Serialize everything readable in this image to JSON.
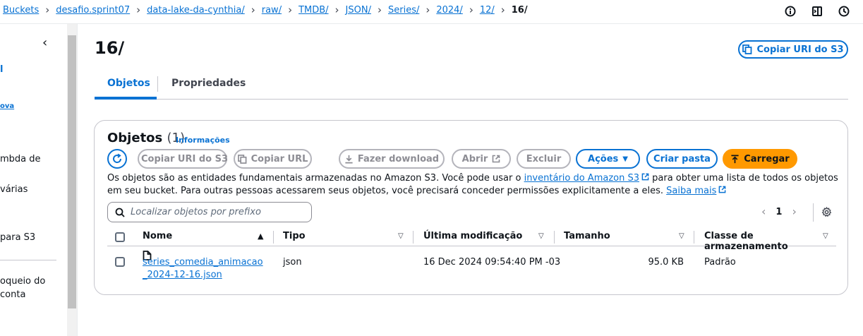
{
  "breadcrumbs": [
    "Buckets",
    "desafio.sprint07",
    "data-lake-da-cynthia/",
    "raw/",
    "TMDB/",
    "JSON/",
    "Series/",
    "2024/",
    "12/"
  ],
  "breadcrumb_current": "16/",
  "leftnav": {
    "fragments": [
      "l",
      "ova",
      "mbda de",
      "várias",
      "para S3",
      "oqueio do",
      "conta"
    ]
  },
  "page": {
    "title": "16/",
    "copy_uri_label": "Copiar URI do S3"
  },
  "tabs": [
    {
      "label": "Objetos",
      "active": true
    },
    {
      "label": "Propriedades",
      "active": false
    }
  ],
  "panel": {
    "title": "Objetos",
    "count": "(1)",
    "info_link": "Informações"
  },
  "toolbar": {
    "copy_s3_uri": "Copiar URI do S3",
    "copy_url": "Copiar URL",
    "download": "Fazer download",
    "open": "Abrir",
    "delete": "Excluir",
    "actions": "Ações",
    "create_folder": "Criar pasta",
    "upload": "Carregar"
  },
  "description": {
    "part1": "Os objetos são as entidades fundamentais armazenadas no Amazon S3. Você pode usar o ",
    "link1": "inventário do Amazon S3",
    "part2": " para obter uma lista de todos os objetos em seu bucket. Para outras pessoas acessarem seus objetos, você precisará conceder permissões explicitamente a eles. ",
    "link2": "Saiba mais"
  },
  "search": {
    "placeholder": "Localizar objetos por prefixo"
  },
  "pagination": {
    "current_page": "1"
  },
  "table": {
    "columns": [
      "Nome",
      "Tipo",
      "Última modificação",
      "Tamanho",
      "Classe de armazenamento"
    ],
    "rows": [
      {
        "name": "series_comedia_animacao_2024-12-16.json",
        "type": "json",
        "last_modified": "16 Dec 2024 09:54:40 PM -03",
        "size": "95.0 KB",
        "storage_class": "Padrão"
      }
    ]
  },
  "colors": {
    "link": "#0972d3",
    "primary": "#ff9900",
    "border": "#c6c6cd",
    "text": "#0f141a"
  }
}
